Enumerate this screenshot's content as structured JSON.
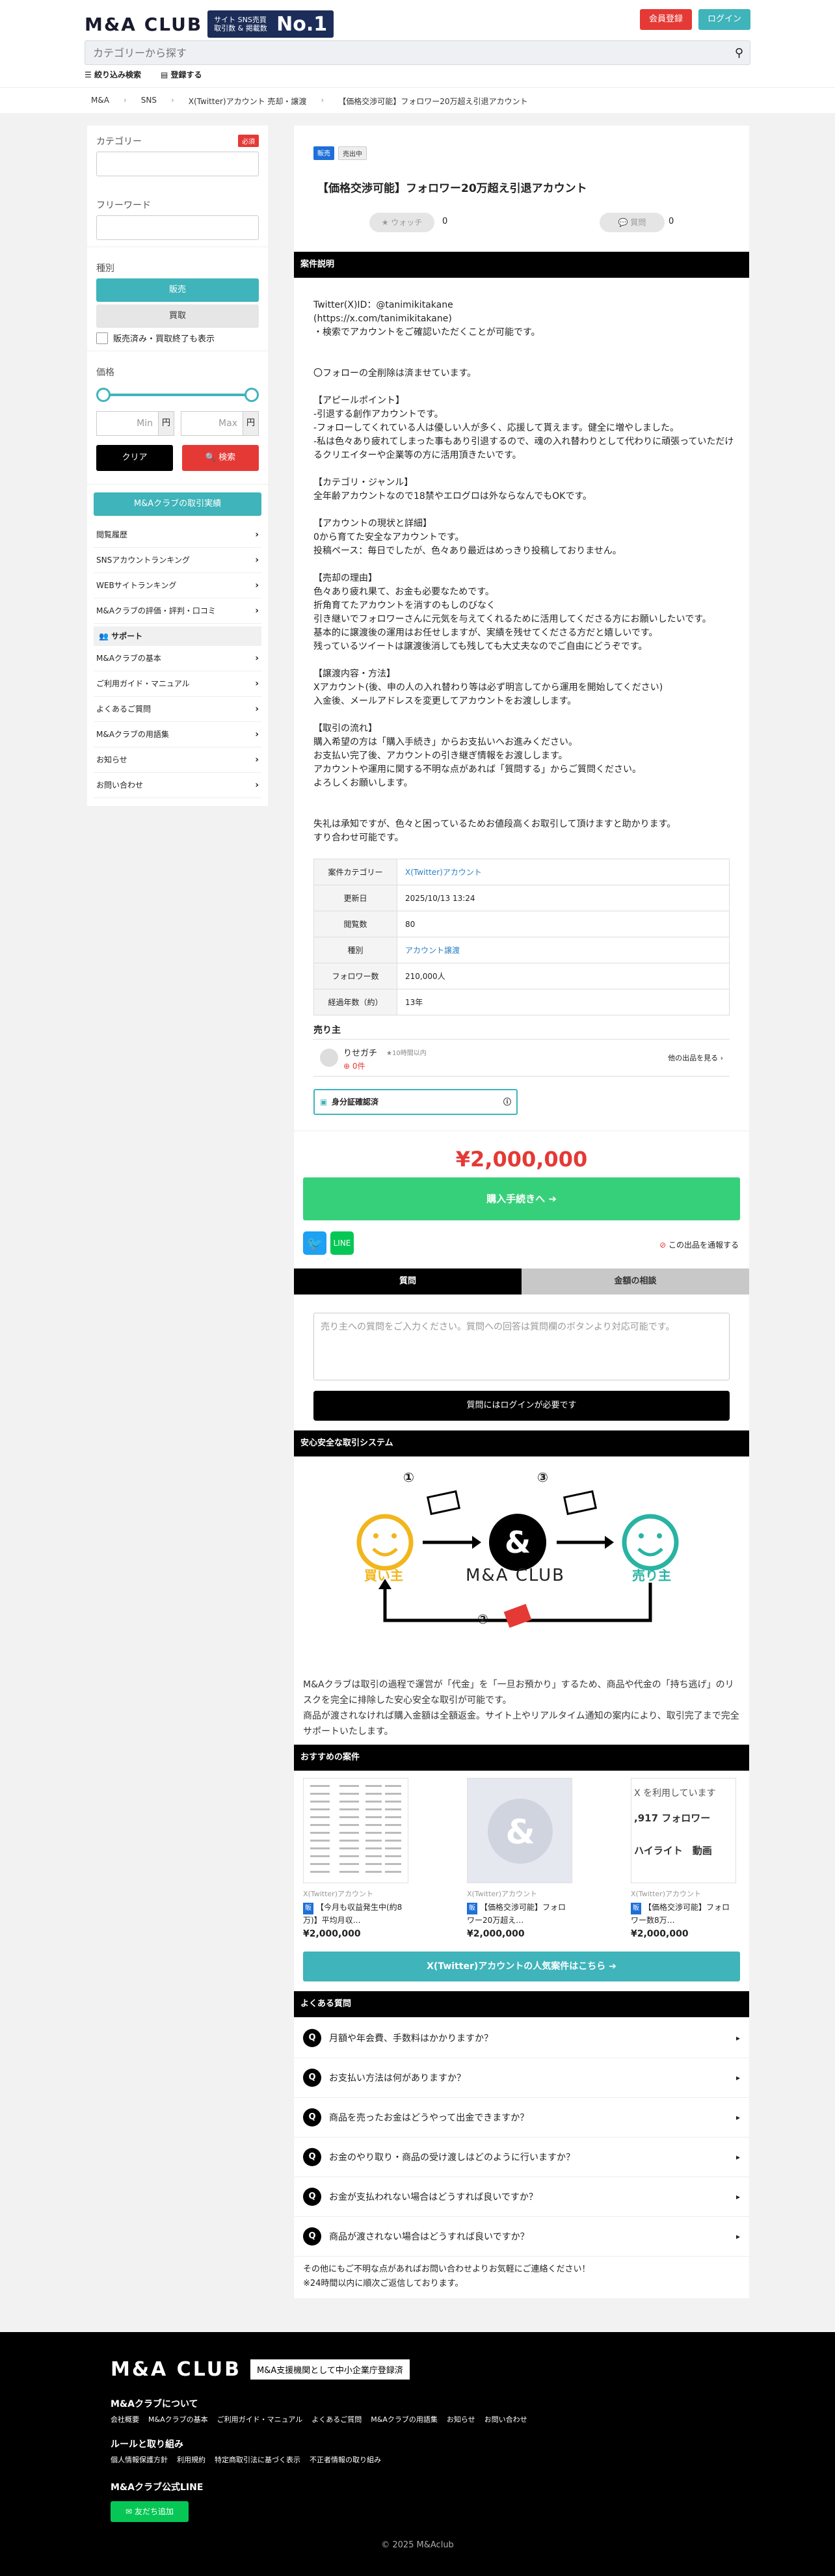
{
  "header": {
    "logo": "M&A CLUB",
    "badge_small": "サイト SNS売買 取引数 & 掲載数",
    "badge_big": "No.1",
    "register": "会員登録",
    "login": "ログイン",
    "search_placeholder": "カテゴリーから探す",
    "filter": "絞り込み検索",
    "listing": "登録する"
  },
  "breadcrumb": [
    "M&A",
    "SNS",
    "X(Twitter)アカウント 売却・譲渡",
    "【価格交渉可能】フォロワー20万超え引退アカウント"
  ],
  "sidebar": {
    "category_label": "カテゴリー",
    "required": "必須",
    "free_word_label": "フリーワード",
    "kind_label": "種別",
    "kind_sell": "販売",
    "kind_buy": "買取",
    "show_sold": "販売済み・買取終了も表示",
    "price_label": "価格",
    "min": "Min",
    "max": "Max",
    "yen": "円",
    "clear": "クリア",
    "search": "🔍 検索",
    "menu_top": "M&Aクラブの取引実績",
    "menu": [
      "閲覧履歴",
      "SNSアカウントランキング",
      "WEBサイトランキング",
      "M&Aクラブの評価・評判・口コミ"
    ],
    "support_head": "サポート",
    "support": [
      "M&Aクラブの基本",
      "ご利用ガイド・マニュアル",
      "よくあるご質問",
      "M&Aクラブの用語集",
      "お知らせ",
      "お問い合わせ"
    ]
  },
  "listing": {
    "tag_sale": "販売",
    "tag_status": "売出中",
    "title": "【価格交渉可能】フォロワー20万超え引退アカウント",
    "watch": "★ ウォッチ",
    "watch_count": "0",
    "question": "質問",
    "question_count": "0",
    "section_desc": "案件説明",
    "description": "Twitter(X)ID：@tanimikitakane\n(https://x.com/tanimikitakane)\n・検索でアカウントをご確認いただくことが可能です。\n\n\n〇フォローの全削除は済ませています。\n\n【アピールポイント】\n-引退する創作アカウントです。\n-フォローしてくれている人は優しい人が多く、応援して貰えます。健全に増やしました。\n-私は色々あり疲れてしまった事もあり引退するので、魂の入れ替わりとして代わりに頑張っていただけるクリエイターや企業等の方に活用頂きたいです。\n\n【カテゴリ・ジャンル】\n全年齢アカウントなので18禁やエログロは外ならなんでもOKです。\n\n【アカウントの現状と詳細】\n0から育てた安全なアカウントです。\n投稿ペース：毎日でしたが、色々あり最近はめっきり投稿しておりません。\n\n【売却の理由】\n色々あり疲れ果て、お金も必要なためです。\n折角育てたアカウントを消すのもしのびなく\n引き継いでフォロワーさんに元気を与えてくれるために活用してくださる方にお願いしたいです。\n基本的に譲渡後の運用はお任せしますが、実績を残せてくださる方だと嬉しいです。\n残っているツイートは譲渡後消しても残しても大丈夫なのでご自由にどうぞです。\n\n【譲渡内容・方法】\nXアカウント(後、申の人の入れ替わり等は必ず明言してから運用を開始してください)\n入金後、メールアドレスを変更してアカウントをお渡しします。\n\n【取引の流れ】\n購入希望の方は「購入手続き」からお支払いへお進みください。\nお支払い完了後、アカウントの引き継ぎ情報をお渡しします。\nアカウントや運用に関する不明な点があれば「質問する」からご質問ください。\nよろしくお願いします。\n\n\n失礼は承知ですが、色々と困っているためお値段高くお取引して頂けますと助かります。\nすり合わせ可能です。",
    "specs": [
      {
        "k": "案件カテゴリー",
        "v": "X(Twitter)アカウント",
        "link": true
      },
      {
        "k": "更新日",
        "v": "2025/10/13 13:24",
        "link": false
      },
      {
        "k": "閲覧数",
        "v": "80",
        "link": false
      },
      {
        "k": "種別",
        "v": "アカウント譲渡",
        "link": true
      },
      {
        "k": "フォロワー数",
        "v": "210,000人",
        "link": false
      },
      {
        "k": "経過年数（約）",
        "v": "13年",
        "link": false
      }
    ],
    "seller_label": "売り主",
    "seller_name": "りせガチ",
    "seller_rating": "★10時間以内",
    "seller_deals": "0件",
    "seller_more": "他の出品を見る ›",
    "id_verified": "身分証確認済",
    "price": "¥2,000,000",
    "buy_button": "購入手続きへ ➔",
    "report": "この出品を通報する",
    "tab_question": "質問",
    "tab_history": "金額の相談",
    "q_placeholder": "売り主への質問をご入力ください。質問への回答は質問欄のボタンより対応可能です。",
    "q_button": "質問にはログインが必要です"
  },
  "safe": {
    "title": "安心安全な取引システム",
    "buyer": "買い主",
    "seller": "売り主",
    "club": "M&A CLUB",
    "step1": "①",
    "step2": "②",
    "step3": "③",
    "text": "M&Aクラブは取引の過程で運営が「代金」を「一旦お預かり」するため、商品や代金の「持ち逃げ」のリスクを完全に排除した安心安全な取引が可能です。\n商品が渡されなければ購入金額は全額返金。サイト上やリアルタイム通知の案内により、取引完了まで完全サポートいたします。"
  },
  "recommend": {
    "title": "おすすめの案件",
    "cards": [
      {
        "cat": "X(Twitter)アカウント",
        "badge": "販",
        "title": "【今月も収益発生中(約8万)】平均月収…",
        "price": "¥2,000,000"
      },
      {
        "cat": "X(Twitter)アカウント",
        "badge": "販",
        "title": "【価格交渉可能】フォロワー20万超え…",
        "price": "¥2,000,000"
      },
      {
        "cat": "X(Twitter)アカウント",
        "badge": "販",
        "title": "【価格交渉可能】フォロワー数8万…",
        "price": "¥2,000,000"
      }
    ],
    "card3_line1": "X を利用しています",
    "card3_line2": ",917 フォロワー",
    "card3_line3": "ハイライト　動画",
    "more_button": "X(Twitter)アカウントの人気案件はこちら ➔"
  },
  "faq": {
    "title": "よくある質問",
    "items": [
      "月額や年会費、手数料はかかりますか？",
      "お支払い方法は何がありますか？",
      "商品を売ったお金はどうやって出金できますか？",
      "お金のやり取り・商品の受け渡しはどのように行いますか？",
      "お金が支払われない場合はどうすれば良いですか？",
      "商品が渡されない場合はどうすれば良いですか？"
    ],
    "note1": "その他にもご不明な点があればお問い合わせよりお気軽にご連絡ください！",
    "note2": "※24時間以内に順次ご返信しております。"
  },
  "footer": {
    "logo": "M&A CLUB",
    "tagline": "M&A支援機関として中小企業庁登録済",
    "about": "M&Aクラブについて",
    "about_links": [
      "会社概要",
      "M&Aクラブの基本",
      "ご利用ガイド・マニュアル",
      "よくあるご質問",
      "M&Aクラブの用語集",
      "お知らせ",
      "お問い合わせ"
    ],
    "rules": "ルールと取り組み",
    "rules_links": [
      "個人情報保護方針",
      "利用規約",
      "特定商取引法に基づく表示",
      "不正者情報の取り組み"
    ],
    "line_head": "M&Aクラブ公式LINE",
    "line_btn": "友だち追加",
    "copyright": "© 2025 M&Aclub"
  }
}
